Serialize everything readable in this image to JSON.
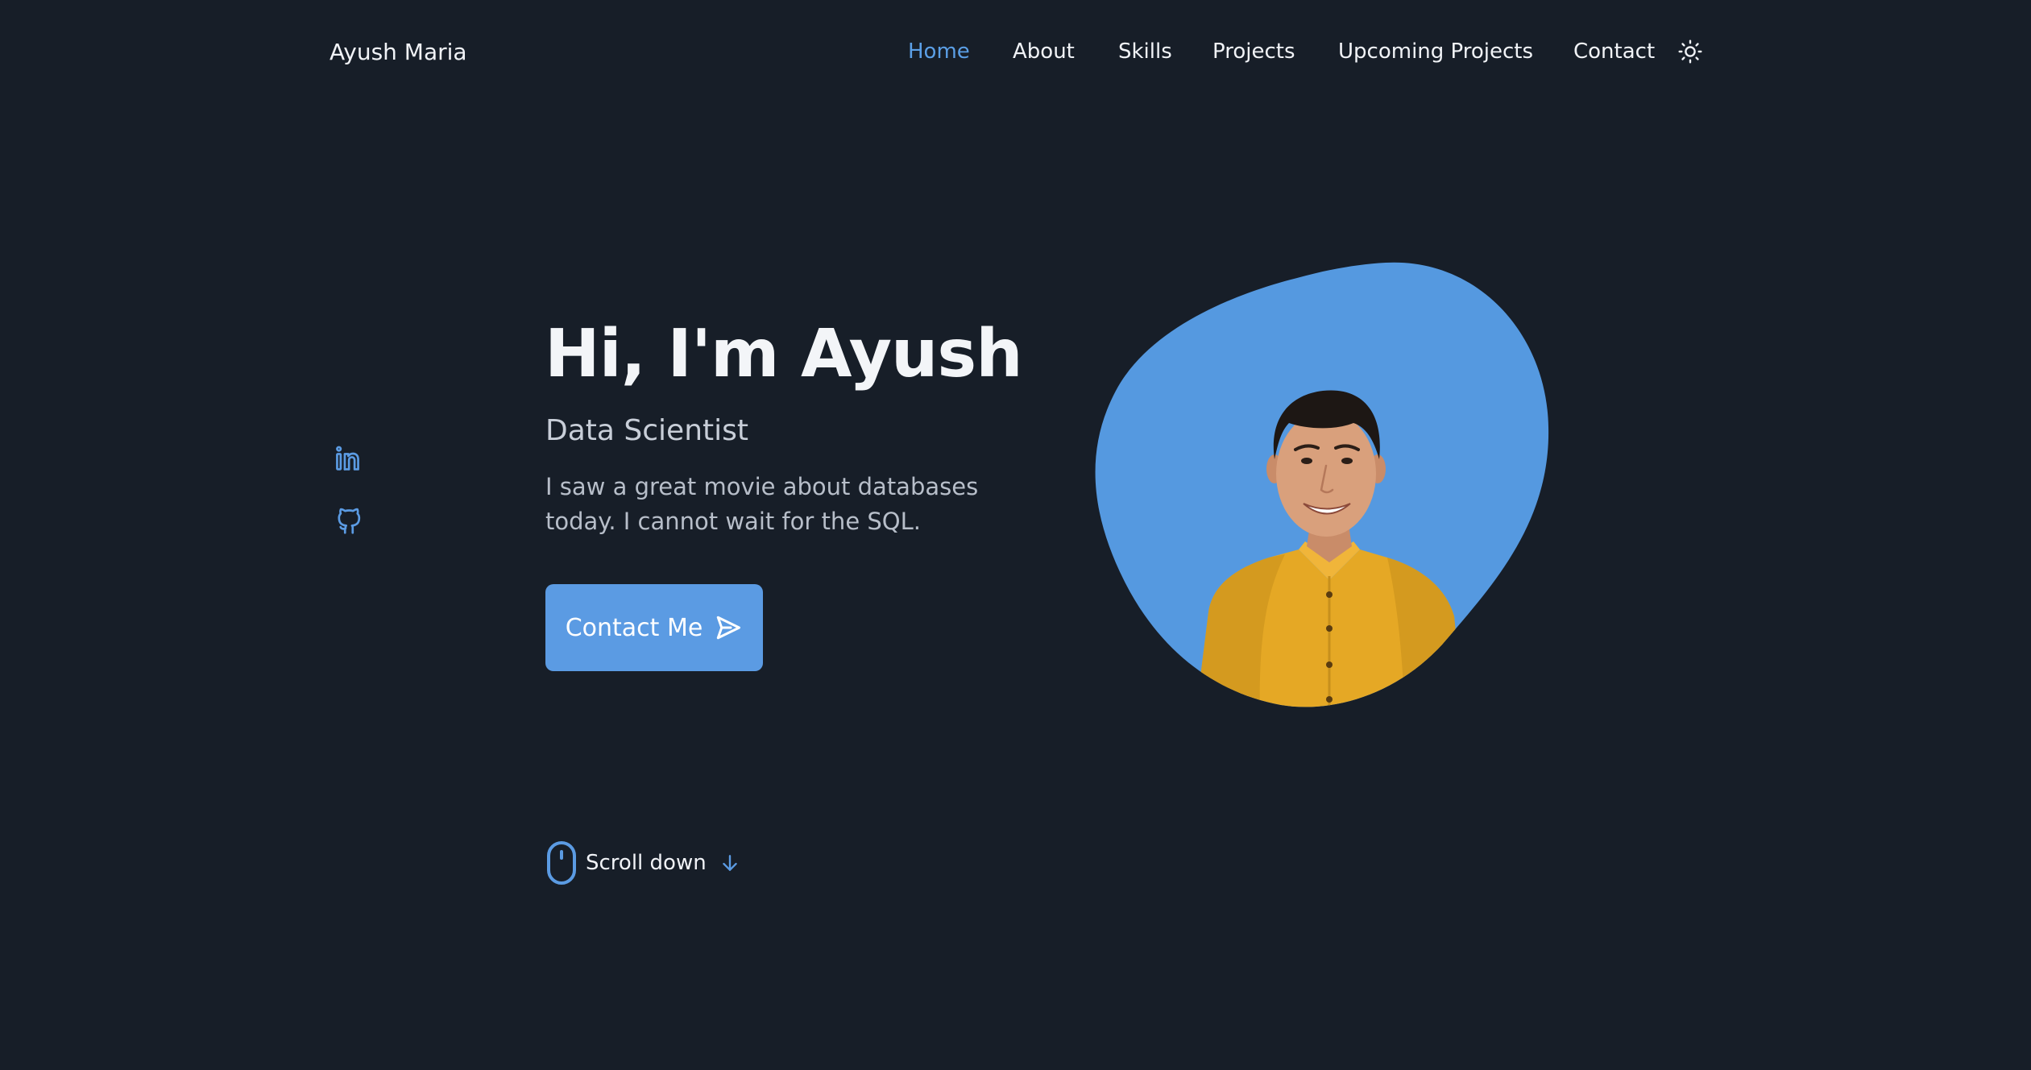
{
  "header": {
    "logo": "Ayush Maria",
    "nav": [
      {
        "label": "Home",
        "active": true
      },
      {
        "label": "About",
        "active": false
      },
      {
        "label": "Skills",
        "active": false
      },
      {
        "label": "Projects",
        "active": false
      },
      {
        "label": "Upcoming Projects",
        "active": false
      },
      {
        "label": "Contact",
        "active": false
      }
    ],
    "theme_icon": "sun-icon"
  },
  "social": [
    {
      "icon": "linkedin-icon"
    },
    {
      "icon": "github-icon"
    }
  ],
  "hero": {
    "title": "Hi, I'm Ayush",
    "subtitle": "Data Scientist",
    "description": "I saw a great movie about databases today. I cannot wait for the SQL.",
    "cta_label": "Contact Me",
    "cta_icon": "send-icon",
    "image": "profile-photo"
  },
  "scroll": {
    "label": "Scroll down",
    "icon": "mouse-icon",
    "arrow_icon": "arrow-down-icon"
  },
  "colors": {
    "background": "#171e28",
    "accent": "#5b9be3",
    "text": "#f1f3f7",
    "muted_text": "#b7bec9",
    "shirt": "#e5a825"
  }
}
